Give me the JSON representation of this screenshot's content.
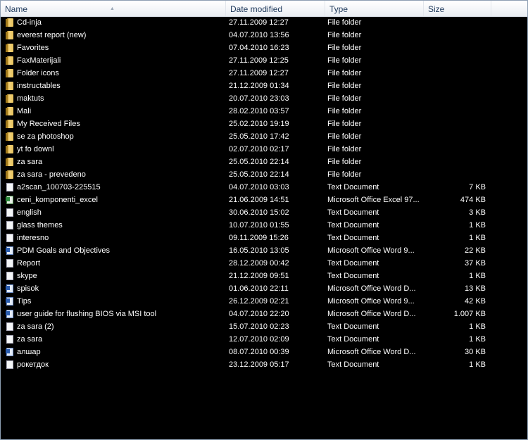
{
  "columns": {
    "name": "Name",
    "date": "Date modified",
    "type": "Type",
    "size": "Size"
  },
  "files": [
    {
      "name": "Cd-inja",
      "date": "27.11.2009 12:27",
      "type": "File folder",
      "size": "",
      "icon": "folder"
    },
    {
      "name": "everest report (new)",
      "date": "04.07.2010 13:56",
      "type": "File folder",
      "size": "",
      "icon": "folder"
    },
    {
      "name": "Favorites",
      "date": "07.04.2010 16:23",
      "type": "File folder",
      "size": "",
      "icon": "folder"
    },
    {
      "name": "FaxMaterijali",
      "date": "27.11.2009 12:25",
      "type": "File folder",
      "size": "",
      "icon": "folder"
    },
    {
      "name": "Folder icons",
      "date": "27.11.2009 12:27",
      "type": "File folder",
      "size": "",
      "icon": "folder"
    },
    {
      "name": "instructables",
      "date": "21.12.2009 01:34",
      "type": "File folder",
      "size": "",
      "icon": "folder"
    },
    {
      "name": "maktuts",
      "date": "20.07.2010 23:03",
      "type": "File folder",
      "size": "",
      "icon": "folder"
    },
    {
      "name": "Mali",
      "date": "28.02.2010 03:57",
      "type": "File folder",
      "size": "",
      "icon": "folder"
    },
    {
      "name": "My Received Files",
      "date": "25.02.2010 19:19",
      "type": "File folder",
      "size": "",
      "icon": "folder"
    },
    {
      "name": "se za photoshop",
      "date": "25.05.2010 17:42",
      "type": "File folder",
      "size": "",
      "icon": "folder"
    },
    {
      "name": "yt fo downl",
      "date": "02.07.2010 02:17",
      "type": "File folder",
      "size": "",
      "icon": "folder"
    },
    {
      "name": "za sara",
      "date": "25.05.2010 22:14",
      "type": "File folder",
      "size": "",
      "icon": "folder"
    },
    {
      "name": "za sara - prevedeno",
      "date": "25.05.2010 22:14",
      "type": "File folder",
      "size": "",
      "icon": "folder"
    },
    {
      "name": "a2scan_100703-225515",
      "date": "04.07.2010 03:03",
      "type": "Text Document",
      "size": "7 KB",
      "icon": "txt"
    },
    {
      "name": "ceni_komponenti_excel",
      "date": "21.06.2009 14:51",
      "type": "Microsoft Office Excel 97...",
      "size": "474 KB",
      "icon": "xls"
    },
    {
      "name": "english",
      "date": "30.06.2010 15:02",
      "type": "Text Document",
      "size": "3 KB",
      "icon": "txt"
    },
    {
      "name": "glass themes",
      "date": "10.07.2010 01:55",
      "type": "Text Document",
      "size": "1 KB",
      "icon": "txt"
    },
    {
      "name": "interesno",
      "date": "09.11.2009 15:26",
      "type": "Text Document",
      "size": "1 KB",
      "icon": "txt"
    },
    {
      "name": "PDM Goals and Objectives",
      "date": "16.05.2010 13:05",
      "type": "Microsoft Office Word 9...",
      "size": "22 KB",
      "icon": "doc"
    },
    {
      "name": "Report",
      "date": "28.12.2009 00:42",
      "type": "Text Document",
      "size": "37 KB",
      "icon": "txt"
    },
    {
      "name": "skype",
      "date": "21.12.2009 09:51",
      "type": "Text Document",
      "size": "1 KB",
      "icon": "txt"
    },
    {
      "name": "spisok",
      "date": "01.06.2010 22:11",
      "type": "Microsoft Office Word D...",
      "size": "13 KB",
      "icon": "doc"
    },
    {
      "name": "Tips",
      "date": "26.12.2009 02:21",
      "type": "Microsoft Office Word 9...",
      "size": "42 KB",
      "icon": "doc"
    },
    {
      "name": "user guide for flushing BIOS via MSI tool",
      "date": "04.07.2010 22:20",
      "type": "Microsoft Office Word D...",
      "size": "1.007 KB",
      "icon": "doc"
    },
    {
      "name": "za sara (2)",
      "date": "15.07.2010 02:23",
      "type": "Text Document",
      "size": "1 KB",
      "icon": "txt"
    },
    {
      "name": "za sara",
      "date": "12.07.2010 02:09",
      "type": "Text Document",
      "size": "1 KB",
      "icon": "txt"
    },
    {
      "name": "алшар",
      "date": "08.07.2010 00:39",
      "type": "Microsoft Office Word D...",
      "size": "30 KB",
      "icon": "doc"
    },
    {
      "name": "рокетдок",
      "date": "23.12.2009 05:17",
      "type": "Text Document",
      "size": "1 KB",
      "icon": "txt"
    }
  ]
}
